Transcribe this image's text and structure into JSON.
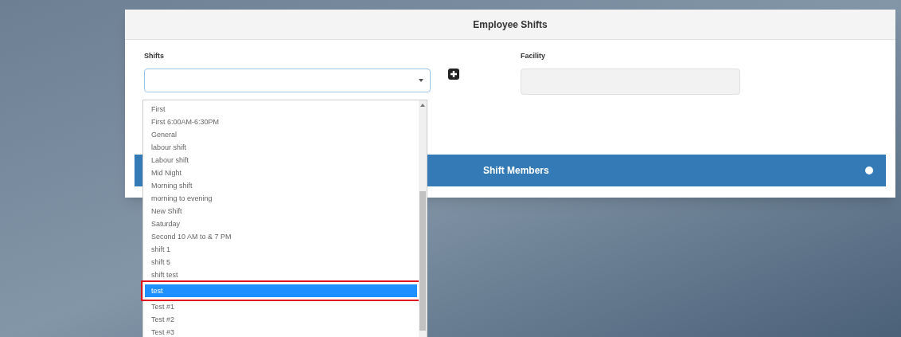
{
  "panel": {
    "title": "Employee Shifts"
  },
  "shifts": {
    "label": "Shifts",
    "expanded": true,
    "options": [
      {
        "label": "First",
        "selected": false
      },
      {
        "label": "First 6:00AM-6:30PM",
        "selected": false
      },
      {
        "label": "General",
        "selected": false
      },
      {
        "label": "labour shift",
        "selected": false
      },
      {
        "label": "Labour shift",
        "selected": false
      },
      {
        "label": "Mid Night",
        "selected": false
      },
      {
        "label": "Morning shift",
        "selected": false
      },
      {
        "label": "morning to evening",
        "selected": false
      },
      {
        "label": "New Shift",
        "selected": false
      },
      {
        "label": "Saturday",
        "selected": false
      },
      {
        "label": "Second 10 AM to & 7 PM",
        "selected": false
      },
      {
        "label": "shift 1",
        "selected": false
      },
      {
        "label": "shift 5",
        "selected": false
      },
      {
        "label": "shift test",
        "selected": false
      },
      {
        "label": "test",
        "selected": true
      },
      {
        "label": "Test #1",
        "selected": false
      },
      {
        "label": "Test #2",
        "selected": false
      },
      {
        "label": "Test #3",
        "selected": false
      }
    ]
  },
  "facility": {
    "label": "Facility"
  },
  "members_bar": {
    "title": "Shift Members"
  }
}
